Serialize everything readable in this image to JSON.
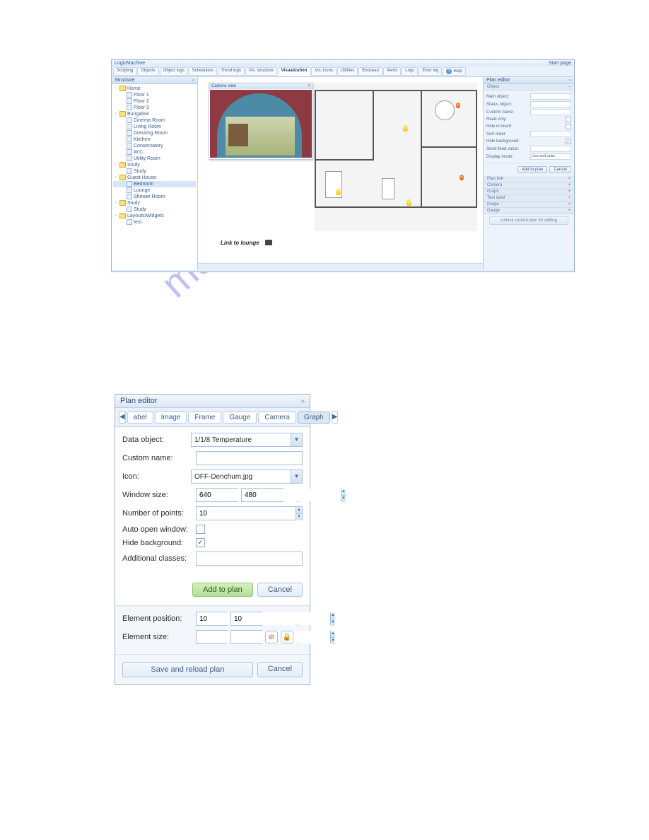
{
  "watermark": "manualshive.com",
  "top": {
    "title": "LogicMachine",
    "start_page": "Start page",
    "tabs": [
      "Scripting",
      "Objects",
      "Object logs",
      "Schedulers",
      "Trend logs",
      "Vis. structure",
      "Visualization",
      "Vis. icons",
      "Utilities",
      "Enocean",
      "Alerts",
      "Logs",
      "Error log"
    ],
    "help": "Help",
    "active_tab": "Visualization",
    "structure": {
      "title": "Structure",
      "tree": [
        {
          "lvl": 0,
          "type": "folder",
          "label": "Home",
          "toggle": "−"
        },
        {
          "lvl": 1,
          "type": "page",
          "label": "Floor 1"
        },
        {
          "lvl": 1,
          "type": "page",
          "label": "Floor 2"
        },
        {
          "lvl": 1,
          "type": "page",
          "label": "Floor 3"
        },
        {
          "lvl": 0,
          "type": "folder",
          "label": "Bungalow",
          "toggle": "−"
        },
        {
          "lvl": 1,
          "type": "page",
          "label": "Cinema Room"
        },
        {
          "lvl": 1,
          "type": "page",
          "label": "Living Room"
        },
        {
          "lvl": 1,
          "type": "page",
          "label": "Dressing Room"
        },
        {
          "lvl": 1,
          "type": "page",
          "label": "Kitchen"
        },
        {
          "lvl": 1,
          "type": "page",
          "label": "Conservatory"
        },
        {
          "lvl": 1,
          "type": "page",
          "label": "W.C."
        },
        {
          "lvl": 1,
          "type": "page",
          "label": "Utility Room"
        },
        {
          "lvl": 0,
          "type": "folder",
          "label": "Study",
          "toggle": "−"
        },
        {
          "lvl": 1,
          "type": "page",
          "label": "Study"
        },
        {
          "lvl": 0,
          "type": "folder",
          "label": "Guest House",
          "toggle": "−"
        },
        {
          "lvl": 1,
          "type": "page",
          "label": "Bedroom",
          "selected": true
        },
        {
          "lvl": 1,
          "type": "page",
          "label": "Lounge"
        },
        {
          "lvl": 1,
          "type": "page",
          "label": "Shower Room"
        },
        {
          "lvl": 0,
          "type": "folder",
          "label": "Study",
          "toggle": "−"
        },
        {
          "lvl": 1,
          "type": "page",
          "label": "Study"
        },
        {
          "lvl": 0,
          "type": "folder",
          "label": "Layouts/Widgets",
          "toggle": "−"
        },
        {
          "lvl": 1,
          "type": "page",
          "label": "test"
        }
      ]
    },
    "camera_view": "Camera view",
    "close_x": "×",
    "link_lounge": "Link to lounge",
    "plan_editor": {
      "title": "Plan editor",
      "section": "Object",
      "rows": [
        {
          "label": "Main object:",
          "type": "combo"
        },
        {
          "label": "Status object:",
          "type": "combo"
        },
        {
          "label": "Custom name:",
          "type": "text"
        },
        {
          "label": "Read-only:",
          "type": "check"
        },
        {
          "label": "Hide in touch:",
          "type": "check"
        },
        {
          "label": "Sort order:",
          "type": "spin"
        },
        {
          "label": "Hide background:",
          "type": "check",
          "checked": true
        },
        {
          "label": "Send fixed value:",
          "type": "text"
        },
        {
          "label": "Display mode:",
          "type": "combo",
          "value": "icon and value"
        }
      ],
      "btn_add": "Add to plan",
      "btn_cancel": "Cancel",
      "accordions": [
        "Plan link",
        "Camera",
        "Graph",
        "Text label",
        "Image",
        "Gauge"
      ],
      "unlock": "Unlock current plan for editing"
    }
  },
  "dialog": {
    "title": "Plan editor",
    "collapse": "»",
    "arrow_left": "◀",
    "arrow_right": "▶",
    "tabs": [
      "abel",
      "Image",
      "Frame",
      "Gauge",
      "Camera",
      "Graph"
    ],
    "active_tab": "Graph",
    "fields": {
      "data_object": {
        "label": "Data object:",
        "value": "1/1/8 Temperature"
      },
      "custom_name": {
        "label": "Custom name:",
        "value": ""
      },
      "icon": {
        "label": "Icon:",
        "value": "OFF-Denchum.jpg"
      },
      "window_size": {
        "label": "Window size:",
        "w": "640",
        "h": "480"
      },
      "num_points": {
        "label": "Number of points:",
        "value": "10"
      },
      "auto_open": {
        "label": "Auto open window:",
        "checked": false
      },
      "hide_bg": {
        "label": "Hide background:",
        "checked": true
      },
      "additional_classes": {
        "label": "Additional classes:",
        "value": ""
      }
    },
    "btn_add": "Add to plan",
    "btn_cancel": "Cancel",
    "element_position": {
      "label": "Element position:",
      "x": "10",
      "y": "10"
    },
    "element_size": {
      "label": "Element size:",
      "w": "",
      "h": ""
    },
    "btn_save": "Save and reload plan",
    "btn_cancel2": "Cancel"
  }
}
